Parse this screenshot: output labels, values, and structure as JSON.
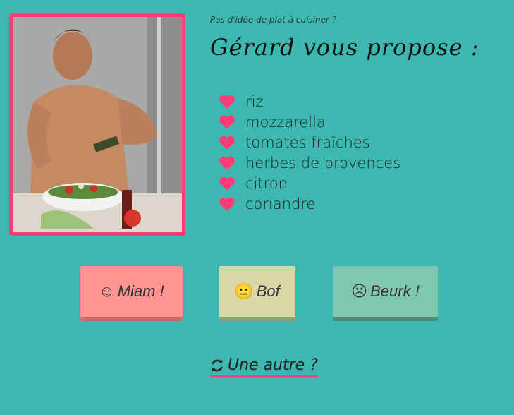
{
  "colors": {
    "background": "#3cb8b0",
    "accent": "#ff3c78",
    "miam_button": "#ff9593",
    "bof_button": "#d9d7a6",
    "beurk_button": "#7fc8ad"
  },
  "header": {
    "tagline": "Pas d'idée de plat à cuisiner ?",
    "title": "Gérard vous propose :"
  },
  "ingredients": [
    {
      "icon": "heart-icon",
      "label": "riz"
    },
    {
      "icon": "heart-icon",
      "label": "mozzarella"
    },
    {
      "icon": "heart-icon",
      "label": "tomates fraîches"
    },
    {
      "icon": "heart-icon",
      "label": "herbes de provences"
    },
    {
      "icon": "heart-icon",
      "label": "citron"
    },
    {
      "icon": "heart-icon",
      "label": "coriandre"
    }
  ],
  "votes": {
    "miam": {
      "emoji": "☺",
      "label": "Miam !"
    },
    "bof": {
      "emoji": "😐",
      "label": "Bof"
    },
    "beurk": {
      "emoji": "☹",
      "label": "Beurk !"
    }
  },
  "another": {
    "icon": "refresh-icon",
    "label": "Une autre ?"
  }
}
